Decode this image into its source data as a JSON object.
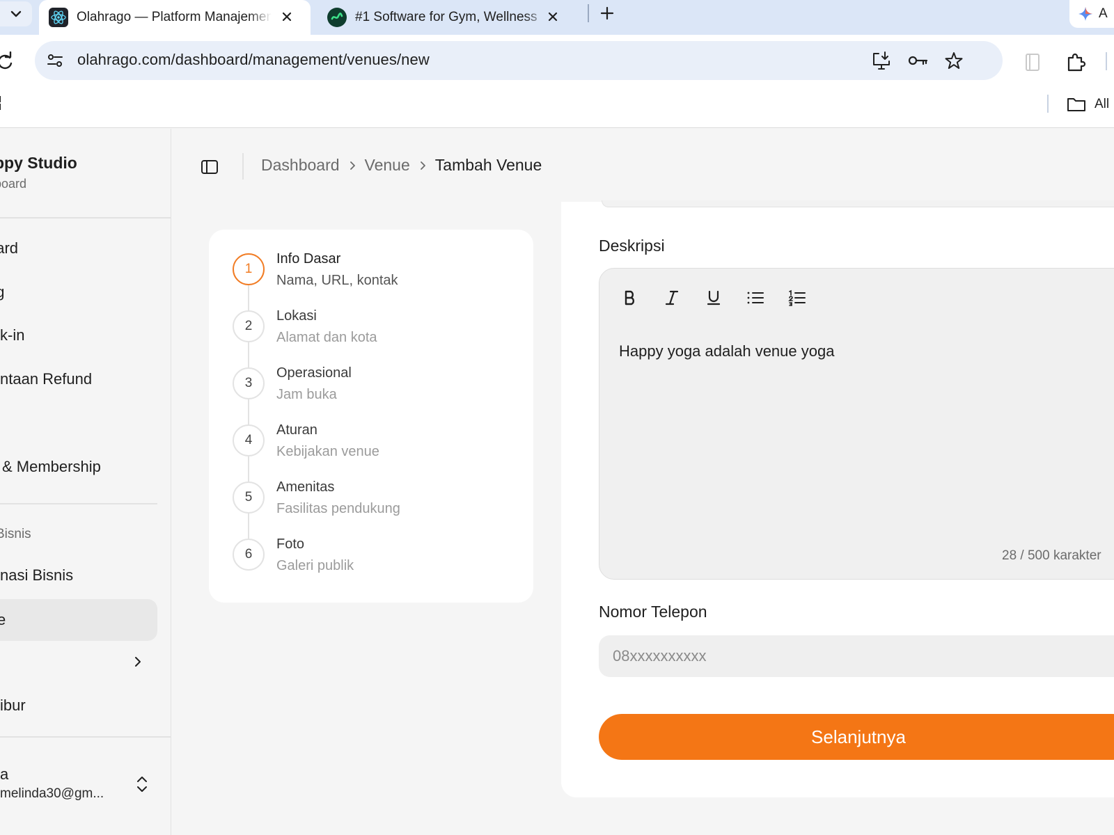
{
  "browser": {
    "tabs": [
      {
        "title": "Olahrago — Platform Manajemen",
        "favicon": "react-icon",
        "active": true
      },
      {
        "title": "#1 Software for Gym, Wellness",
        "favicon": "brand-icon",
        "active": false
      }
    ],
    "ai_label": "A",
    "url": "olahrago.com/dashboard/management/venues/new",
    "bookmarks_label": "All"
  },
  "sidebar": {
    "brand_name": "ppy Studio",
    "brand_sub": "board",
    "items": [
      {
        "label": "oard"
      },
      {
        "label": "ng"
      },
      {
        "label": "k-in"
      },
      {
        "label": "ntaan Refund"
      },
      {
        "label": "& Membership"
      }
    ],
    "section_label": "Bisnis",
    "business_items": [
      {
        "label": "nasi Bisnis"
      },
      {
        "label": "e",
        "active": true
      },
      {
        "label": ""
      },
      {
        "label": "ibur"
      }
    ],
    "user": {
      "name": "a",
      "email": "melinda30@gm..."
    }
  },
  "header": {
    "breadcrumb": [
      "Dashboard",
      "Venue",
      "Tambah Venue"
    ]
  },
  "steps": [
    {
      "number": "1",
      "title": "Info Dasar",
      "subtitle": "Nama, URL, kontak",
      "current": true
    },
    {
      "number": "2",
      "title": "Lokasi",
      "subtitle": "Alamat dan kota"
    },
    {
      "number": "3",
      "title": "Operasional",
      "subtitle": "Jam buka"
    },
    {
      "number": "4",
      "title": "Aturan",
      "subtitle": "Kebijakan venue"
    },
    {
      "number": "5",
      "title": "Amenitas",
      "subtitle": "Fasilitas pendukung"
    },
    {
      "number": "6",
      "title": "Foto",
      "subtitle": "Galeri publik"
    }
  ],
  "form": {
    "description_label": "Deskripsi",
    "description_value": "Happy yoga adalah venue yoga",
    "char_count": "28 / 500 karakter",
    "toolbar": [
      "bold-icon",
      "italic-icon",
      "underline-icon",
      "bullet-list-icon",
      "numbered-list-icon"
    ],
    "phone_label": "Nomor Telepon",
    "phone_placeholder": "08xxxxxxxxxx",
    "phone_value": "",
    "next_button": "Selanjutnya"
  },
  "colors": {
    "accent": "#f47615",
    "step_current": "#f17c24",
    "tabbar": "#dbe6f7"
  }
}
